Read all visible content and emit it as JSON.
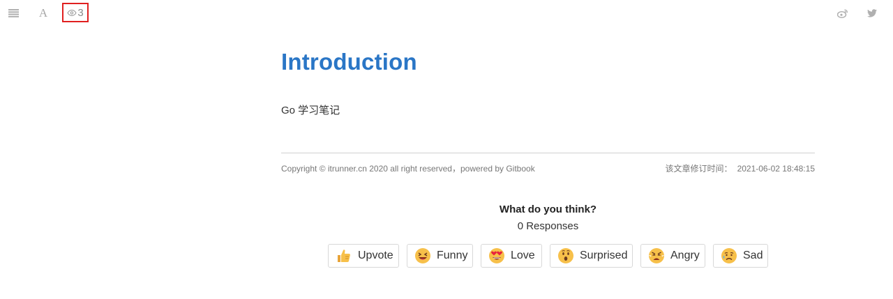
{
  "toolbar": {
    "menu_icon": "hamburger-menu-icon",
    "font_icon_glyph": "A",
    "views_icon": "eye-icon",
    "views_count": "3",
    "weibo_icon": "weibo-icon",
    "twitter_icon": "twitter-icon"
  },
  "page": {
    "title": "Introduction",
    "body_text": "Go 学习笔记"
  },
  "footer": {
    "copyright": "Copyright © itrunner.cn 2020 all right reserved，powered by Gitbook",
    "modified_label": "该文章修订时间：",
    "modified_time": "2021-06-02 18:48:15"
  },
  "feedback": {
    "title": "What do you think?",
    "responses": "0 Responses",
    "reactions": [
      {
        "label": "Upvote",
        "icon": "thumbs-up-emoji"
      },
      {
        "label": "Funny",
        "icon": "laughing-emoji"
      },
      {
        "label": "Love",
        "icon": "heart-eyes-emoji"
      },
      {
        "label": "Surprised",
        "icon": "surprised-emoji"
      },
      {
        "label": "Angry",
        "icon": "angry-emoji"
      },
      {
        "label": "Sad",
        "icon": "sad-emoji"
      }
    ]
  }
}
